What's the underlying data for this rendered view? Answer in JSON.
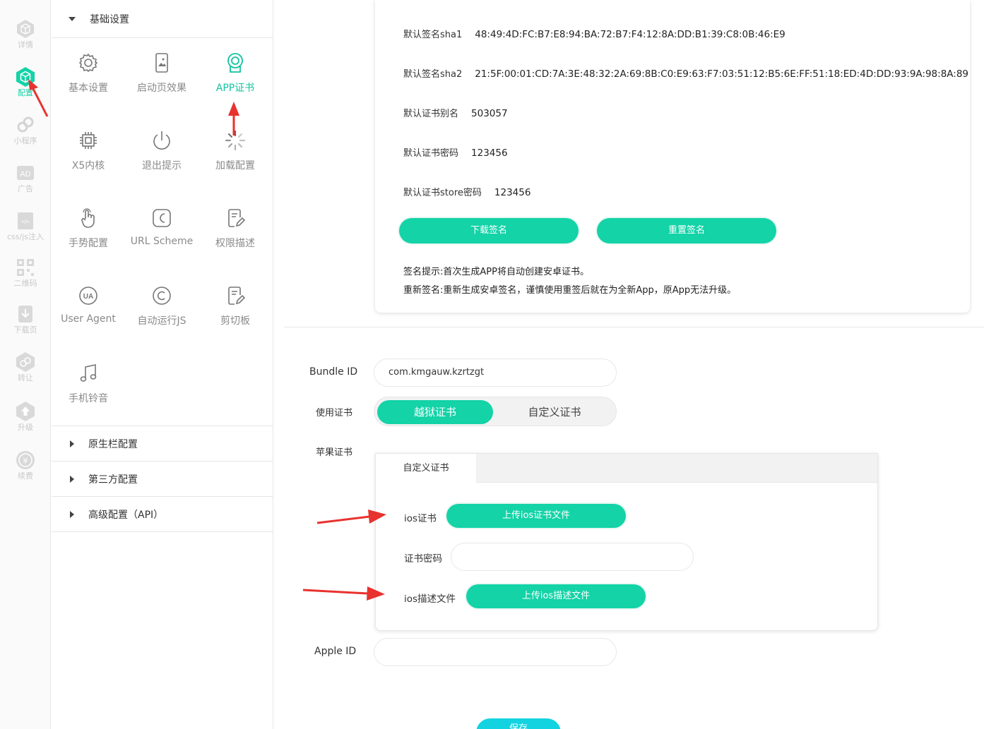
{
  "rail": {
    "items": [
      {
        "label": "详情",
        "icon": "hexagon-detail-icon"
      },
      {
        "label": "配置",
        "icon": "cube-config-icon"
      },
      {
        "label": "小程序",
        "icon": "mini-program-icon"
      },
      {
        "label": "广告",
        "icon": "ad-icon"
      },
      {
        "label": "css/js注入",
        "icon": "code-inject-icon"
      },
      {
        "label": "二维码",
        "icon": "qrcode-icon"
      },
      {
        "label": "下载页",
        "icon": "download-page-icon"
      },
      {
        "label": "转让",
        "icon": "transfer-icon"
      },
      {
        "label": "升级",
        "icon": "upgrade-icon"
      },
      {
        "label": "续费",
        "icon": "renew-icon"
      }
    ],
    "active_color": "#13d3a7"
  },
  "menu": {
    "basic_section": "基础设置",
    "grid": [
      {
        "label": "基本设置",
        "icon": "gear-icon"
      },
      {
        "label": "启动页效果",
        "icon": "phone-image-icon"
      },
      {
        "label": "APP证书",
        "icon": "certificate-icon"
      },
      {
        "label": "X5内核",
        "icon": "chip-icon"
      },
      {
        "label": "退出提示",
        "icon": "power-icon"
      },
      {
        "label": "加载配置",
        "icon": "loading-icon"
      },
      {
        "label": "手势配置",
        "icon": "hand-icon"
      },
      {
        "label": "URL Scheme",
        "icon": "url-scheme-icon"
      },
      {
        "label": "权限描述",
        "icon": "edit-doc-icon"
      },
      {
        "label": "User Agent",
        "icon": "ua-icon"
      },
      {
        "label": "自动运行JS",
        "icon": "copyright-icon"
      },
      {
        "label": "剪切板",
        "icon": "clipboard-icon"
      },
      {
        "label": "手机铃音",
        "icon": "music-icon"
      }
    ],
    "sections": [
      "原生栏配置",
      "第三方配置",
      "高级配置（API）"
    ]
  },
  "android": {
    "rows": [
      {
        "key": "默认签名sha1",
        "value": "48:49:4D:FC:B7:E8:94:BA:72:B7:F4:12:8A:DD:B1:39:C8:0B:46:E9"
      },
      {
        "key": "默认签名sha2",
        "value": "21:5F:00:01:CD:7A:3E:48:32:2A:69:8B:C0:E9:63:F7:03:51:12:B5:6E:FF:51:18:ED:4D:DD:93:9A:98:8A:89"
      },
      {
        "key": "默认证书别名",
        "value": "503057"
      },
      {
        "key": "默认证书密码",
        "value": "123456"
      },
      {
        "key": "默认证书store密码",
        "value": "123456"
      }
    ],
    "download_btn": "下载签名",
    "reset_btn": "重置签名",
    "tip1": "签名提示:首次生成APP将自动创建安卓证书。",
    "tip2": "重新签名:重新生成安卓签名，谨慎使用重签后就在为全新App，原App无法升级。"
  },
  "ios": {
    "bundle_label": "Bundle ID",
    "bundle_value": "com.kmgauw.kzrtzgt",
    "use_cert_label": "使用证书",
    "seg_on": "越狱证书",
    "seg_off": "自定义证书",
    "apple_cert_label": "苹果证书",
    "tab_label": "自定义证书",
    "ios_cert_label": "ios证书",
    "upload_cert_btn": "上传ios证书文件",
    "cert_pwd_label": "证书密码",
    "cert_pwd_value": "",
    "ios_profile_label": "ios描述文件",
    "upload_profile_btn": "上传ios描述文件",
    "apple_id_label": "Apple ID",
    "apple_id_value": "",
    "save_btn": "保存"
  },
  "colors": {
    "accent": "#13d3a7",
    "arrow": "#e8322e"
  }
}
